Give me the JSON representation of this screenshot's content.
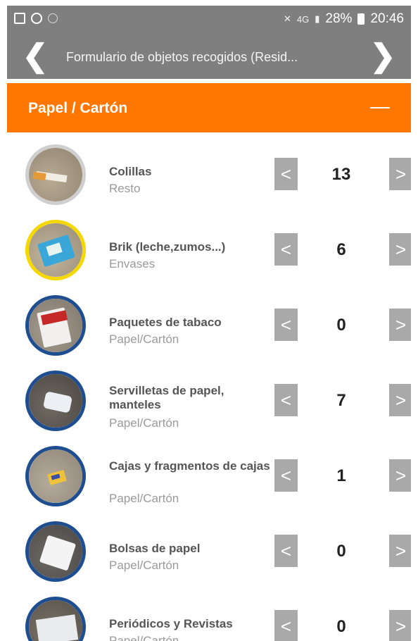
{
  "status_bar": {
    "battery_level": "28%",
    "time": "20:46",
    "network": "4G"
  },
  "toolbar": {
    "title": "Formulario de objetos recogidos (Resid...",
    "prev_symbol": "❮",
    "next_symbol": "❯"
  },
  "section": {
    "title": "Papel / Cartón",
    "color": "#ff7700"
  },
  "stepper": {
    "decrement_symbol": "<",
    "increment_symbol": ">"
  },
  "items": [
    {
      "name": "Colillas",
      "category": "Resto",
      "count": "13",
      "ring_color": "#cfcfcf",
      "icon": "cigarette-butt-icon"
    },
    {
      "name": "Brik (leche,zumos...)",
      "category": "Envases",
      "count": "6",
      "ring_color": "#f5d800",
      "icon": "brik-carton-icon"
    },
    {
      "name": "Paquetes de tabaco",
      "category": "Papel/Cartón",
      "count": "0",
      "ring_color": "#1f4e90",
      "icon": "cigarette-pack-icon"
    },
    {
      "name": "Servilletas de papel, manteles",
      "category": "Papel/Cartón",
      "count": "7",
      "ring_color": "#1f4e90",
      "icon": "napkin-icon"
    },
    {
      "name": "Cajas y fragmentos de cajas",
      "category": "Papel/Cartón",
      "count": "1",
      "ring_color": "#1f4e90",
      "icon": "box-fragment-icon"
    },
    {
      "name": "Bolsas de papel",
      "category": "Papel/Cartón",
      "count": "0",
      "ring_color": "#1f4e90",
      "icon": "paper-bag-icon"
    },
    {
      "name": "Periódicos y Revistas",
      "category": "Papel/Cartón",
      "count": "0",
      "ring_color": "#1f4e90",
      "icon": "newspaper-icon"
    }
  ]
}
